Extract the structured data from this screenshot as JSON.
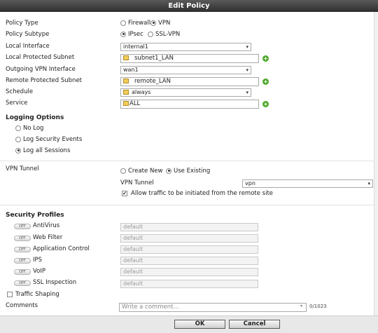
{
  "dialog": {
    "title": "Edit Policy"
  },
  "form": {
    "policy_type": {
      "label": "Policy Type",
      "options": [
        "Firewall",
        "VPN"
      ],
      "selected": "VPN"
    },
    "policy_subtype": {
      "label": "Policy Subtype",
      "options": [
        "IPsec",
        "SSL-VPN"
      ],
      "selected": "IPsec"
    },
    "local_interface": {
      "label": "Local Interface",
      "value": "internal1"
    },
    "local_subnet": {
      "label": "Local Protected Subnet",
      "value": "subnet1_LAN"
    },
    "outgoing_interface": {
      "label": "Outgoing VPN Interface",
      "value": "wan1"
    },
    "remote_subnet": {
      "label": "Remote Protected Subnet",
      "value": "remote_LAN"
    },
    "schedule": {
      "label": "Schedule",
      "value": "always"
    },
    "service": {
      "label": "Service",
      "value": "ALL"
    }
  },
  "logging": {
    "title": "Logging Options",
    "options": [
      "No Log",
      "Log Security Events",
      "Log all Sessions"
    ],
    "selected": "Log all Sessions"
  },
  "vpn": {
    "label": "VPN Tunnel",
    "options": [
      "Create New",
      "Use Existing"
    ],
    "selected": "Use Existing",
    "tunnel_label": "VPN Tunnel",
    "tunnel_value": "vpn",
    "allow_label": "Allow traffic to be initiated from the remote site",
    "allow_checked": true
  },
  "security": {
    "title": "Security Profiles",
    "toggle_text": "OFF",
    "profiles": [
      {
        "name": "AntiVirus",
        "value": "default"
      },
      {
        "name": "Web Filter",
        "value": "default"
      },
      {
        "name": "Application Control",
        "value": "default"
      },
      {
        "name": "IPS",
        "value": "default"
      },
      {
        "name": "VoIP",
        "value": "default"
      },
      {
        "name": "SSL Inspection",
        "value": "default"
      }
    ]
  },
  "traffic_shaping": {
    "label": "Traffic Shaping",
    "checked": false
  },
  "comments": {
    "label": "Comments",
    "placeholder": "Write a comment...",
    "counter": "0/1023"
  },
  "buttons": {
    "ok": "OK",
    "cancel": "Cancel"
  },
  "icons": {
    "address_object": "address-object-icon",
    "add": "add-plus-icon",
    "schedule": "schedule-icon",
    "service": "service-icon",
    "dropdown": "chevron-down-icon"
  },
  "colors": {
    "titlebar": "#3c3c3c",
    "add_button": "#4aa829"
  }
}
